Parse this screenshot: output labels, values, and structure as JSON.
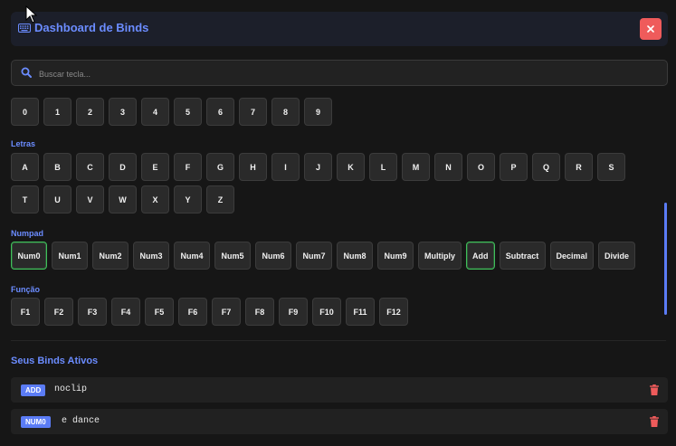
{
  "header": {
    "title": "Dashboard de Binds",
    "close_label": "×"
  },
  "search": {
    "placeholder": "Buscar tecla..."
  },
  "sections": {
    "numeros": {
      "keys": [
        "0",
        "1",
        "2",
        "3",
        "4",
        "5",
        "6",
        "7",
        "8",
        "9"
      ]
    },
    "letras": {
      "label": "Letras",
      "row1": [
        "A",
        "B",
        "C",
        "D",
        "E",
        "F",
        "G",
        "H",
        "I",
        "J",
        "K",
        "L",
        "M",
        "N",
        "O",
        "P",
        "Q",
        "R",
        "S"
      ],
      "row2": [
        "T",
        "U",
        "V",
        "W",
        "X",
        "Y",
        "Z"
      ]
    },
    "numpad": {
      "label": "Numpad",
      "keys": [
        "Num0",
        "Num1",
        "Num2",
        "Num3",
        "Num4",
        "Num5",
        "Num6",
        "Num7",
        "Num8",
        "Num9",
        "Multiply",
        "Add",
        "Subtract",
        "Decimal",
        "Divide"
      ],
      "active": [
        "Num0",
        "Add"
      ]
    },
    "funcao": {
      "label": "Função",
      "keys": [
        "F1",
        "F2",
        "F3",
        "F4",
        "F5",
        "F6",
        "F7",
        "F8",
        "F9",
        "F10",
        "F11",
        "F12"
      ]
    }
  },
  "binds": {
    "title": "Seus Binds Ativos",
    "items": [
      {
        "key": "ADD",
        "command": "noclip"
      },
      {
        "key": "NUM0",
        "command": "e dance"
      }
    ]
  },
  "colors": {
    "accent": "#6b8cff",
    "badge": "#5b7cf5",
    "danger": "#ef5b5b",
    "active_border": "#3fbf5a"
  }
}
